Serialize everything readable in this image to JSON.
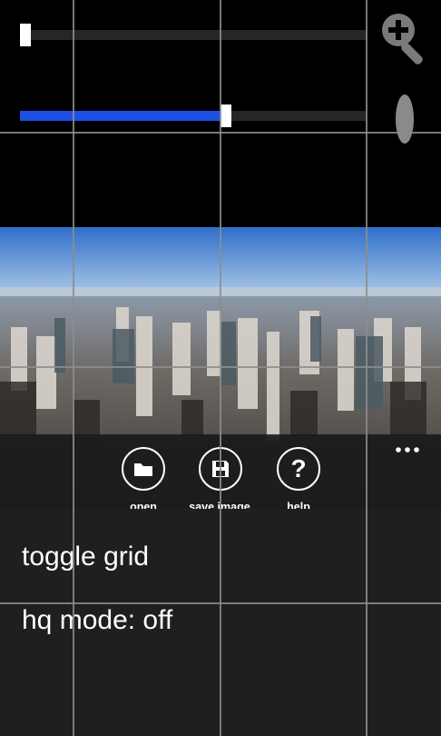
{
  "sliders": {
    "zoom": {
      "value": 0.0
    },
    "angle": {
      "value": 0.6
    }
  },
  "icons": {
    "zoom": "zoom-in-icon",
    "handle": "vertical-handle",
    "open": "folder-icon",
    "save": "floppy-disk-icon",
    "help": "question-mark-icon",
    "more": "ellipsis-icon"
  },
  "app_bar": {
    "buttons": [
      {
        "label": "open\nimage"
      },
      {
        "label": "save image"
      },
      {
        "label": "help"
      }
    ]
  },
  "menu": {
    "items": [
      "toggle grid",
      "hq mode: off"
    ]
  },
  "colors": {
    "accent": "#1f50e6",
    "background": "#000000",
    "menu_background": "#1f1f1f"
  }
}
